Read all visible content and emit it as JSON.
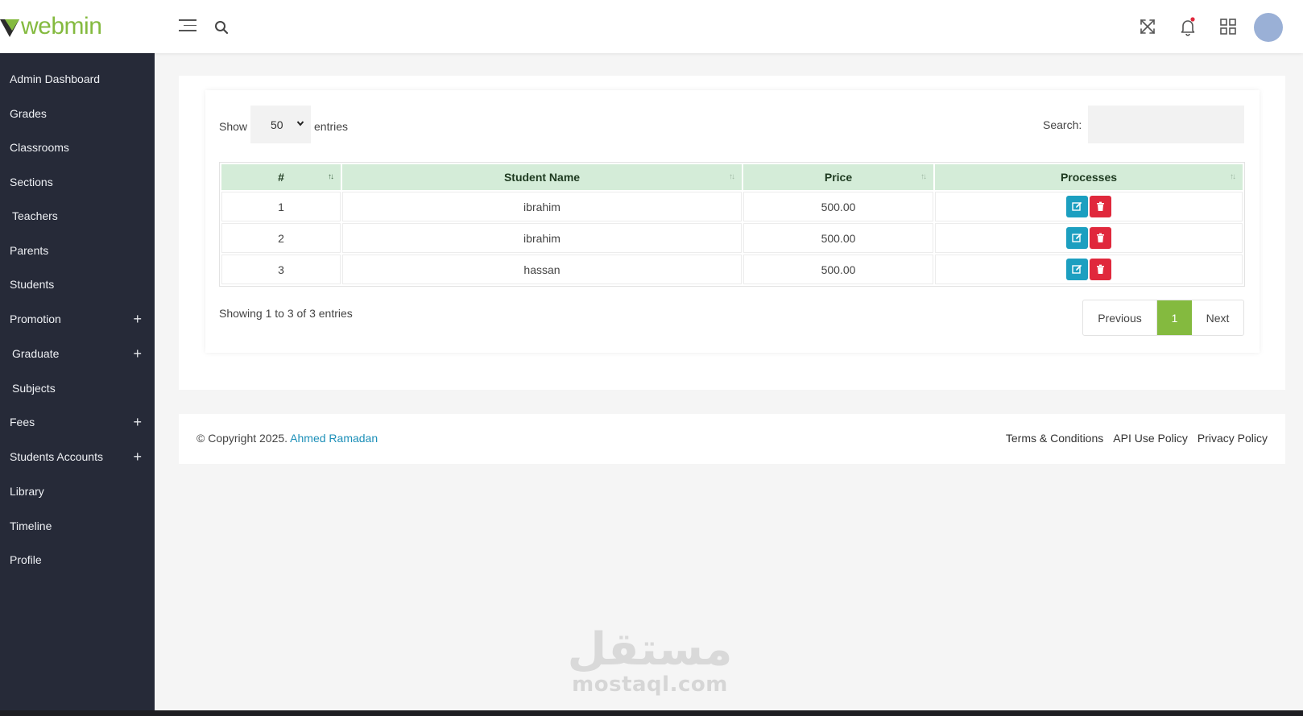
{
  "header": {
    "logo_text": "webmin",
    "icons": [
      "menu-icon",
      "search-icon",
      "fullscreen-icon",
      "bell-icon",
      "grid-icon",
      "avatar"
    ]
  },
  "colors": {
    "brand": "#84ba3f",
    "sidebar_bg": "#262a38",
    "table_header_bg": "#d4ecd8",
    "edit_btn": "#1c9fc0",
    "delete_btn": "#e0283c",
    "link": "#1c8fb8"
  },
  "sidebar": {
    "items": [
      {
        "label": "Admin Dashboard",
        "expandable": false
      },
      {
        "label": "Grades",
        "expandable": false
      },
      {
        "label": "Classrooms",
        "expandable": false
      },
      {
        "label": "Sections",
        "expandable": false
      },
      {
        "label": "Teachers",
        "expandable": false
      },
      {
        "label": "Parents",
        "expandable": false
      },
      {
        "label": "Students",
        "expandable": false
      },
      {
        "label": "Promotion",
        "expandable": true
      },
      {
        "label": "Graduate",
        "expandable": true
      },
      {
        "label": "Subjects",
        "expandable": false
      },
      {
        "label": "Fees",
        "expandable": true
      },
      {
        "label": "Students Accounts",
        "expandable": true
      },
      {
        "label": "Library",
        "expandable": false
      },
      {
        "label": "Timeline",
        "expandable": false
      },
      {
        "label": "Profile",
        "expandable": false
      }
    ],
    "plus_glyph": "+"
  },
  "table": {
    "show_label": "Show",
    "entries_value": "50",
    "entries_label": "entries",
    "search_label": "Search:",
    "search_value": "",
    "columns": [
      "#",
      "Student Name",
      "Price",
      "Processes"
    ],
    "rows": [
      {
        "num": "1",
        "name": "ibrahim",
        "price": "500.00"
      },
      {
        "num": "2",
        "name": "ibrahim",
        "price": "500.00"
      },
      {
        "num": "3",
        "name": "hassan",
        "price": "500.00"
      }
    ],
    "showing_text": "Showing 1 to 3 of 3 entries",
    "pagination": {
      "previous": "Previous",
      "current": "1",
      "next": "Next"
    }
  },
  "footer": {
    "copyright_prefix": "© Copyright 2025.",
    "author": "Ahmed Ramadan",
    "links": [
      "Terms & Conditions",
      "API Use Policy",
      "Privacy Policy"
    ]
  },
  "watermark": {
    "arabic": "مستقل",
    "latin": "mostaql.com"
  }
}
